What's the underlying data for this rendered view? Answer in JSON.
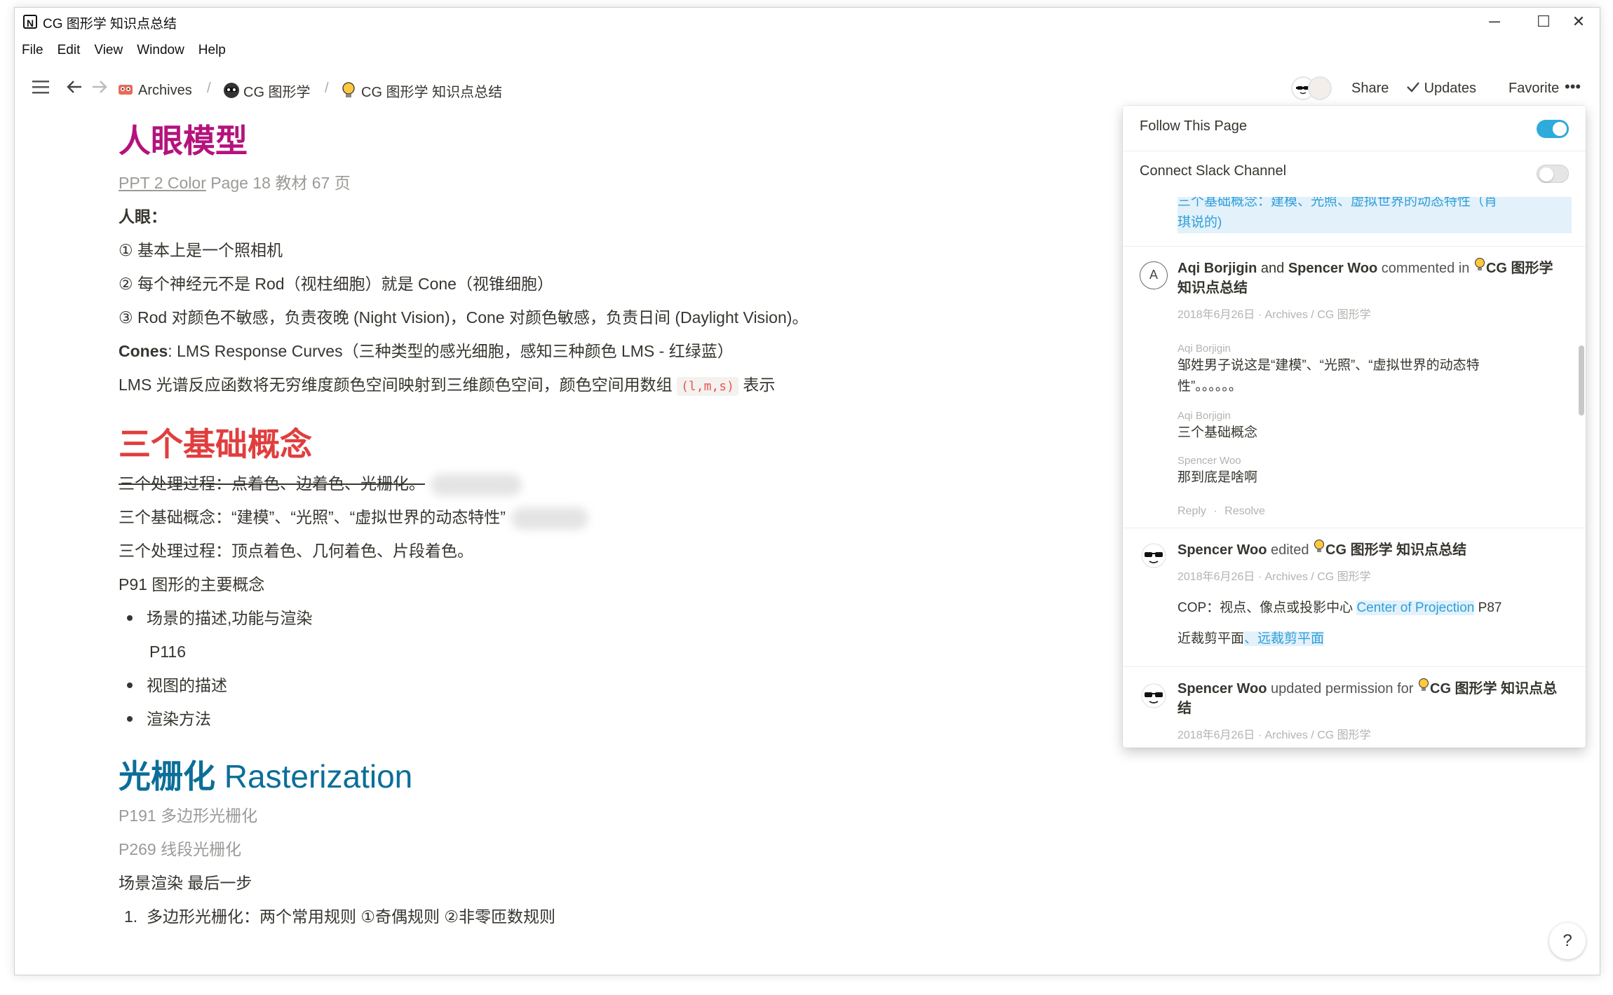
{
  "window": {
    "title": "CG 图形学 知识点总结",
    "app_icon": "N",
    "minimize": "─",
    "maximize": "☐",
    "close": "✕"
  },
  "menu": [
    "File",
    "Edit",
    "View",
    "Window",
    "Help"
  ],
  "topbar": {
    "breadcrumbs": [
      {
        "label": "Archives",
        "icon": "archives-emoji-icon"
      },
      {
        "label": "CG 图形学",
        "icon": "robot-face-icon"
      },
      {
        "label": "CG 图形学 知识点总结",
        "icon": "lightbulb-icon"
      }
    ],
    "separator": "/",
    "share": "Share",
    "updates": "Updates",
    "favorite": "Favorite",
    "more": "•••"
  },
  "colors": {
    "h1_magenta": "#b5127d",
    "h1_red": "#e03e3e",
    "h1_blue": "#0b6e99",
    "toggle_on": "#2eaadc",
    "toggle_off": "#e5e5e5",
    "link": "#2e9fd8"
  },
  "content": {
    "h1_eye": "人眼模型",
    "ref_link": "PPT 2 Color",
    "ref_rest": " Page 18 教材 67 页",
    "eye_label": "人眼：",
    "eye_1": "① 基本上是一个照相机",
    "eye_2": "② 每个神经元不是 Rod（视柱细胞）就是 Cone（视锥细胞）",
    "eye_3": "③ Rod 对颜色不敏感，负责夜晚 (Night Vision)，Cone 对颜色敏感，负责日间 (Daylight Vision)。",
    "cones_bold": "Cones",
    "cones_rest": ": LMS Response Curves（三种类型的感光细胞，感知三种颜色 LMS - 红绿蓝）",
    "lms_text": "LMS 光谱反应函数将无穷维度颜色空间映射到三维颜色空间，颜色空间用数组 ",
    "lms_code": "(l,m,s)",
    "lms_tail": " 表示",
    "h1_concepts": "三个基础概念",
    "strike_line": "三个处理过程：点着色、边着色、光栅化。",
    "concept_line": "三个基础概念：“建模”、“光照”、“虚拟世界的动态特性”",
    "process_line": "三个处理过程：顶点着色、几何着色、片段着色。",
    "p91": "P91 图形的主要概念",
    "bullets": [
      "场景的描述,功能与渲染",
      "视图的描述",
      "渲染方法"
    ],
    "p116": "P116",
    "h1_raster_cn": "光栅化",
    "h1_raster_en": " Rasterization",
    "p191": "P191 多边形光栅化",
    "p269": "P269 线段光栅化",
    "last_step": "场景渲染 最后一步",
    "numbered_1_no": "1.",
    "numbered_1": "多边形光栅化：两个常用规则 ①奇偶规则 ②非零匝数规则"
  },
  "popup": {
    "follow_label": "Follow This Page",
    "follow_on": true,
    "slack_label": "Connect Slack Channel",
    "slack_on": false,
    "partial_top": "三个基础概念：建模、光照、虚拟世界的动态特性（肖",
    "partial_bottom": "琪说的)",
    "entries": {
      "comment": {
        "avatar_letter": "A",
        "user1": "Aqi Borjigin",
        "and": " and ",
        "user2": "Spencer Woo",
        "action": " commented in ",
        "page": "CG 图形学 知识点总结",
        "meta": "2018年6月26日 · Archives / CG 图形学",
        "c1_author": "Aqi Borjigin",
        "c1_text": "邹姓男子说这是“建模”、“光照”、“虚拟世界的动态特性”。。。。。。",
        "c2_author": "Aqi Borjigin",
        "c2_text": "三个基础概念",
        "c3_author": "Spencer Woo",
        "c3_text": "那到底是啥啊",
        "reply": "Reply",
        "dot": "·",
        "resolve": "Resolve"
      },
      "edit": {
        "user": "Spencer Woo",
        "action": " edited ",
        "page": "CG 图形学 知识点总结",
        "meta": "2018年6月26日 · Archives / CG 图形学",
        "line1_a": "COP：视点、像点或投影中心 ",
        "line1_link": "Center of Projection",
        "line1_b": " P87",
        "line2_a": "近裁剪平面",
        "line2_link": "、远裁剪平面"
      },
      "perm": {
        "user": "Spencer Woo",
        "action": " updated permission for ",
        "page": "CG 图形学 知识点总结",
        "meta": "2018年6月26日 · Archives / CG 图形学"
      }
    }
  },
  "help": "?"
}
